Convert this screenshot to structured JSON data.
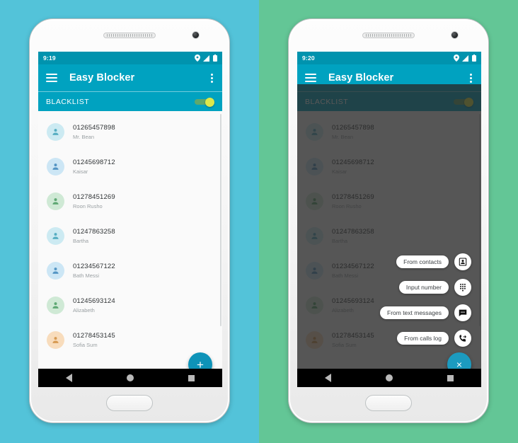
{
  "theme": {
    "left_background": "#53C3D9",
    "right_background": "#63C696",
    "appbar_color": "#00A2C0",
    "statusbar_color": "#0093AE",
    "fab_color": "#0E93B8",
    "toggle_thumb": "#DCE84B",
    "toggle_track": "#5FA86C"
  },
  "panels": [
    {
      "id": "panel-left",
      "statusbar": {
        "time": "9:19",
        "icons": [
          "location-icon",
          "signal-icon",
          "battery-icon"
        ]
      },
      "appbar": {
        "menu_icon": "hamburger-icon",
        "title": "Easy Blocker",
        "overflow_icon": "kebab-menu-icon"
      },
      "subbar": {
        "label": "BLACKLIST",
        "toggle_state": "on"
      },
      "fab": {
        "label": "+",
        "name": "add-fab"
      },
      "overlay": false
    },
    {
      "id": "panel-right",
      "statusbar": {
        "time": "9:20",
        "icons": [
          "location-icon",
          "signal-icon",
          "battery-icon"
        ]
      },
      "appbar": {
        "menu_icon": "hamburger-icon",
        "title": "Easy Blocker",
        "overflow_icon": "kebab-menu-icon"
      },
      "subbar": {
        "label": "BLACKLIST",
        "toggle_state": "on"
      },
      "fab": {
        "label": "×",
        "name": "close-fab"
      },
      "overlay": true
    }
  ],
  "contacts": [
    {
      "number": "01265457898",
      "name": "Mr. Bean",
      "avatar_color": "#CCEAF2",
      "icon_color": "#57AEC2"
    },
    {
      "number": "01245698712",
      "name": "Kaisar",
      "avatar_color": "#CCE6F5",
      "icon_color": "#5495C4"
    },
    {
      "number": "01278451269",
      "name": "Roon Rusho",
      "avatar_color": "#CFE9D5",
      "icon_color": "#5FA874"
    },
    {
      "number": "01247863258",
      "name": "Bartha",
      "avatar_color": "#CCEAF2",
      "icon_color": "#57AEC2"
    },
    {
      "number": "01234567122",
      "name": "Bath Messi",
      "avatar_color": "#CCE6F5",
      "icon_color": "#5495C4"
    },
    {
      "number": "01245693124",
      "name": "Alizabeth",
      "avatar_color": "#CFE9D5",
      "icon_color": "#5FA874"
    },
    {
      "number": "01278453145",
      "name": "Sofia Sum",
      "avatar_color": "#F8DCBC",
      "icon_color": "#D79A52"
    }
  ],
  "speed_dial": [
    {
      "label": "From contacts",
      "icon": "contact-card-icon"
    },
    {
      "label": "Input number",
      "icon": "dialpad-icon"
    },
    {
      "label": "From text messages",
      "icon": "message-icon"
    },
    {
      "label": "From calls log",
      "icon": "call-log-icon"
    }
  ],
  "navbar": {
    "back": "back-triangle-icon",
    "home": "home-circle-icon",
    "recents": "recents-square-icon"
  }
}
